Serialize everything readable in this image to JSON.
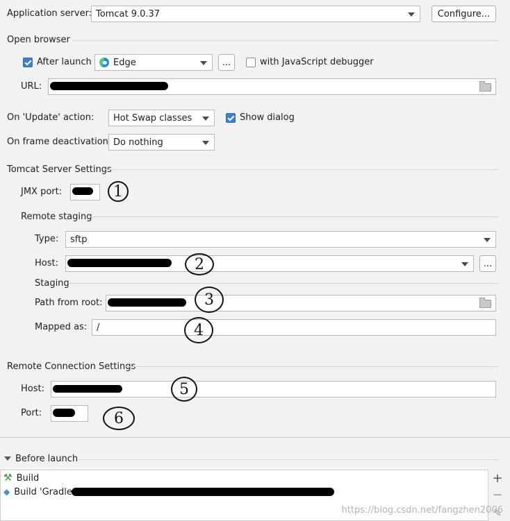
{
  "app_server": {
    "label": "Application server:",
    "value": "Tomcat 9.0.37",
    "configure_label": "Configure..."
  },
  "open_browser": {
    "title": "Open browser",
    "after_launch_label": "After launch",
    "after_launch_checked": true,
    "browser_value": "Edge",
    "dots_label": "...",
    "js_debugger_label": "with JavaScript debugger",
    "js_debugger_checked": false,
    "url_label": "URL:"
  },
  "update_action": {
    "label": "On 'Update' action:",
    "value": "Hot Swap classes",
    "show_dialog_label": "Show dialog",
    "show_dialog_checked": true
  },
  "frame_deactivation": {
    "label": "On frame deactivation:",
    "value": "Do nothing"
  },
  "tomcat_settings": {
    "title": "Tomcat Server Settings",
    "jmx_label": "JMX port:"
  },
  "remote_staging": {
    "title": "Remote staging",
    "type_label": "Type:",
    "type_value": "sftp",
    "host_label": "Host:",
    "dots_label": "...",
    "staging_title": "Staging",
    "path_label": "Path from root:",
    "mapped_label": "Mapped as:",
    "mapped_value": "/"
  },
  "remote_connection": {
    "title": "Remote Connection Settings",
    "host_label": "Host:",
    "port_label": "Port:"
  },
  "annotations": {
    "n1": "1",
    "n2": "2",
    "n3": "3",
    "n4": "4",
    "n5": "5",
    "n6": "6"
  },
  "before_launch": {
    "title": "Before launch",
    "items": [
      {
        "label": "Build",
        "icon": "hammer-icon"
      },
      {
        "label": "Build 'Gradle :",
        "icon": "gradle-icon"
      }
    ],
    "add_label": "+",
    "remove_label": "−"
  },
  "watermark": "https://blog.csdn.net/fangzhen2006"
}
